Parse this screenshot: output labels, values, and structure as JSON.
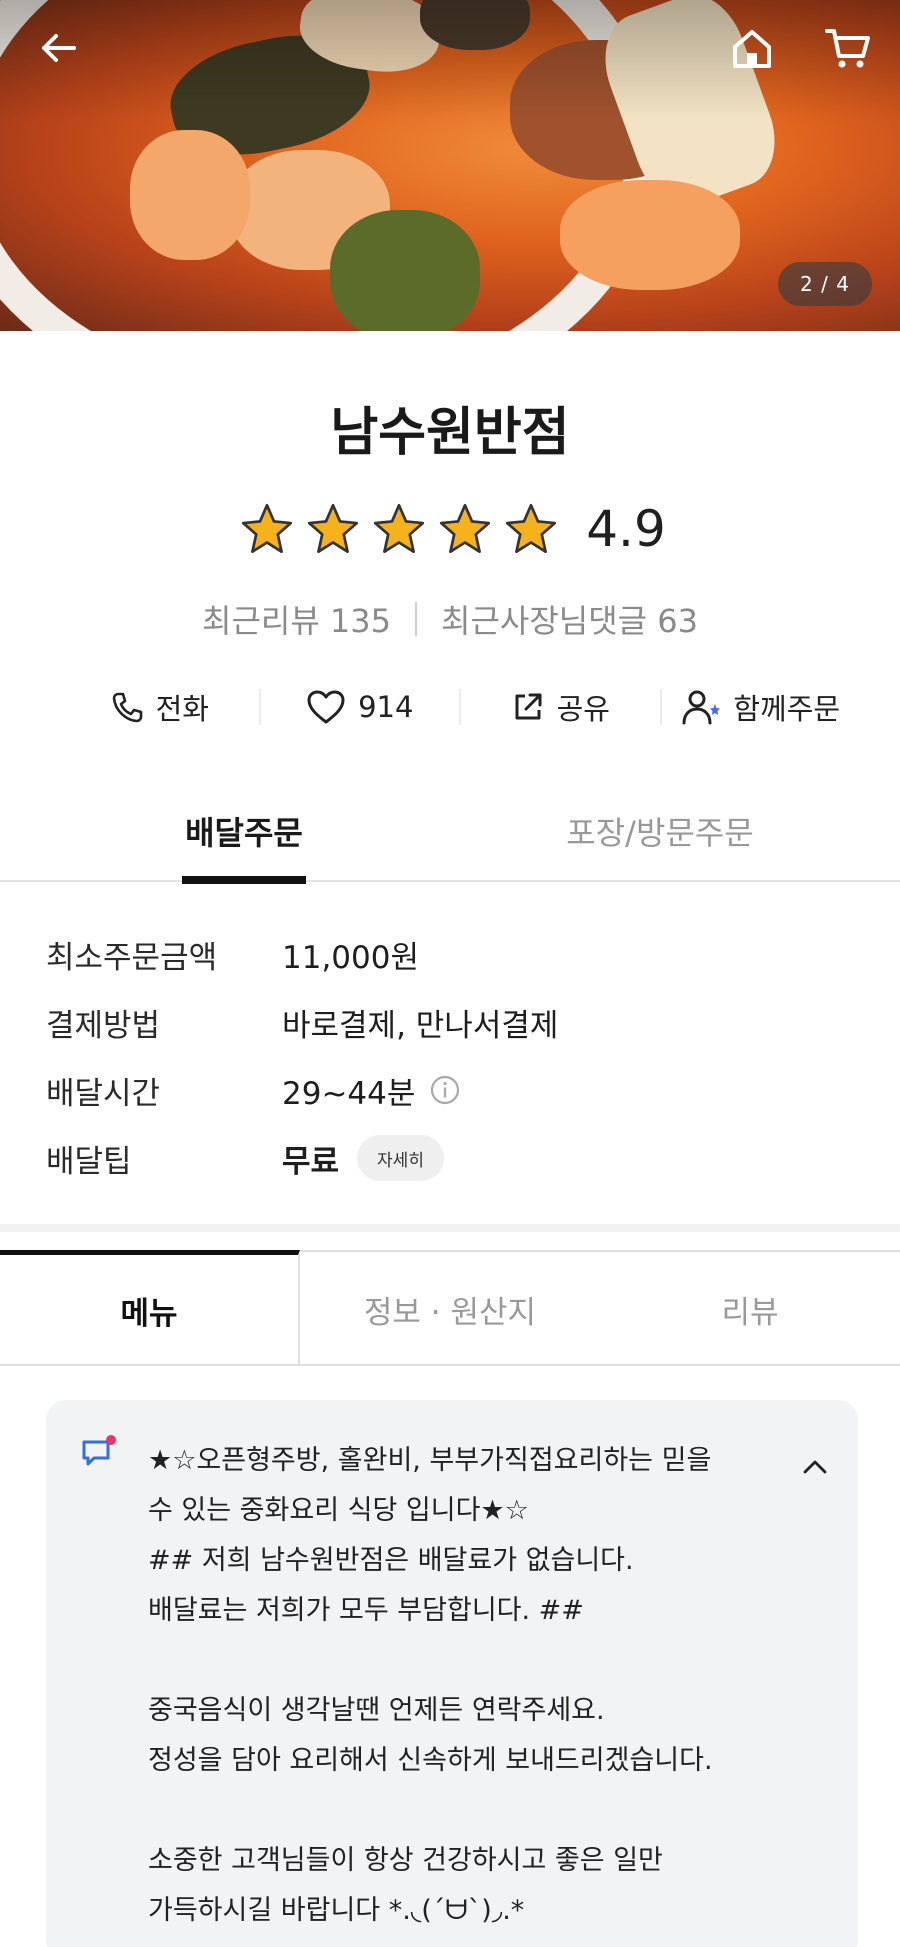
{
  "header": {
    "image_counter": "2 / 4",
    "icons": {
      "back": "arrow-left-icon",
      "home": "home-icon",
      "cart": "cart-icon"
    }
  },
  "store": {
    "name": "남수원반점",
    "rating": "4.9",
    "stars": 5,
    "recent_reviews_label": "최근리뷰 135",
    "owner_replies_label": "최근사장님댓글 63"
  },
  "actions": [
    {
      "label": "전화",
      "icon": "phone-icon"
    },
    {
      "label": "914",
      "icon": "heart-icon"
    },
    {
      "label": "공유",
      "icon": "share-icon"
    },
    {
      "label": "함께주문",
      "icon": "group-order-icon"
    }
  ],
  "order_tabs": {
    "delivery": "배달주문",
    "pickup": "포장/방문주문"
  },
  "info": {
    "min_order": {
      "label": "최소주문금액",
      "value": "11,000원"
    },
    "payment": {
      "label": "결제방법",
      "value": "바로결제, 만나서결제"
    },
    "delivery_time": {
      "label": "배달시간",
      "value": "29~44분"
    },
    "delivery_tip": {
      "label": "배달팁",
      "value": "무료",
      "chip": "자세히"
    }
  },
  "menu_tabs": {
    "menu": "메뉴",
    "info": "정보 · 원산지",
    "reviews": "리뷰"
  },
  "notice": {
    "text": "★☆오픈형주방, 홀완비, 부부가직접요리하는 믿을\n수 있는 중화요리 식당 입니다★☆\n## 저희 남수원반점은 배달료가 없습니다.\n배달료는 저희가 모두 부담합니다. ##\n\n중국음식이 생각날땐 언제든 연락주세요.\n정성을 담아 요리해서 신속하게 보내드리겠습니다.\n\n소중한 고객님들이 항상 건강하시고 좋은 일만\n가득하시길 바랍니다 *.◟(ˊᗨˋ)◞.*"
  },
  "colors": {
    "star": "#f6b21b",
    "accent_dot": "#e8336b",
    "notice_icon": "#2f6fe4"
  }
}
